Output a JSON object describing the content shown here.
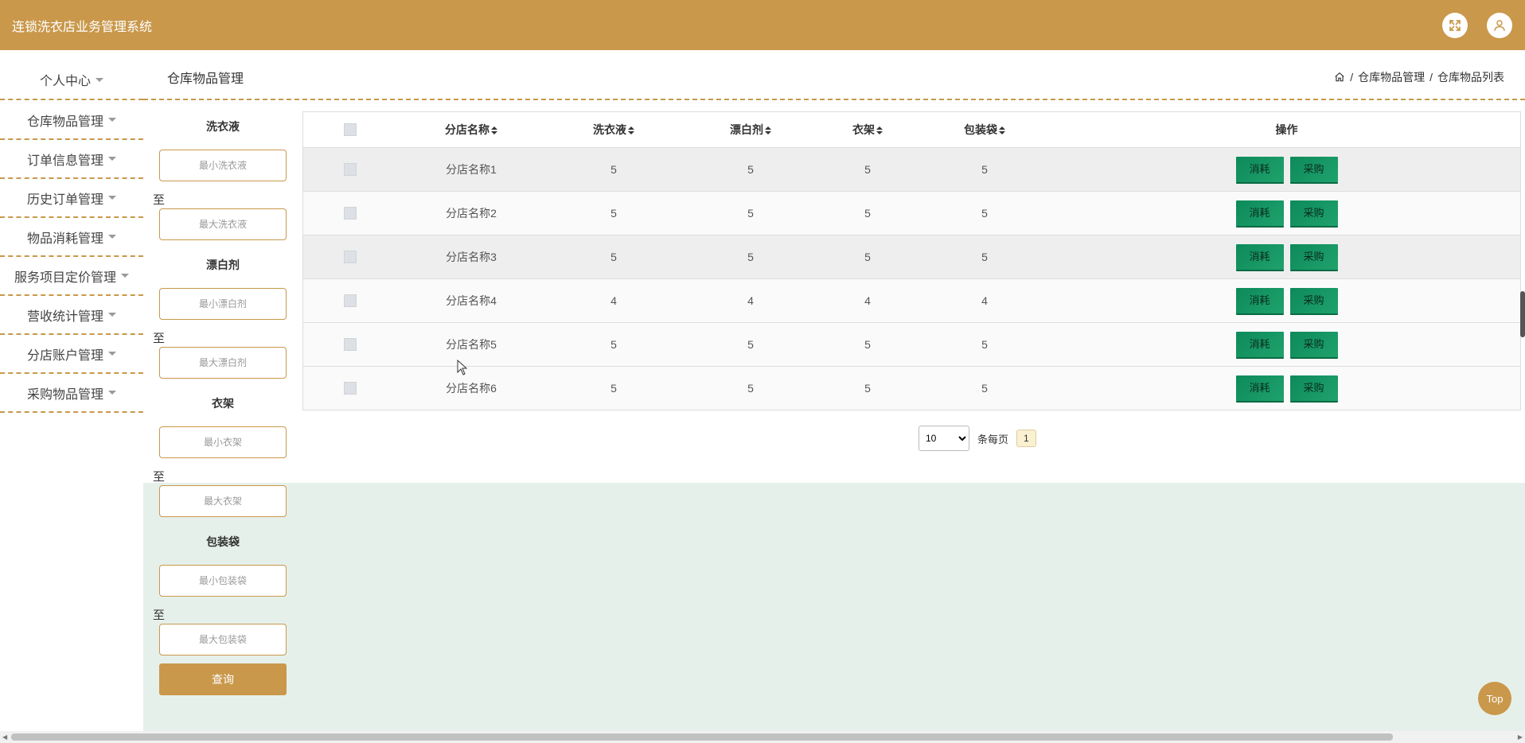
{
  "app": {
    "title": "连锁洗衣店业务管理系统"
  },
  "header_icons": [
    "fullscreen-icon",
    "user-icon"
  ],
  "sidebar": {
    "items": [
      {
        "label": "个人中心"
      },
      {
        "label": "仓库物品管理"
      },
      {
        "label": "订单信息管理"
      },
      {
        "label": "历史订单管理"
      },
      {
        "label": "物品消耗管理"
      },
      {
        "label": "服务项目定价管理"
      },
      {
        "label": "营收统计管理"
      },
      {
        "label": "分店账户管理"
      },
      {
        "label": "采购物品管理"
      }
    ]
  },
  "page": {
    "title": "仓库物品管理",
    "breadcrumb": [
      "仓库物品管理",
      "仓库物品列表"
    ],
    "breadcrumb_sep": "/"
  },
  "filters": {
    "to_label": "至",
    "groups": [
      {
        "label": "洗衣液",
        "min_placeholder": "最小洗衣液",
        "max_placeholder": "最大洗衣液"
      },
      {
        "label": "漂白剂",
        "min_placeholder": "最小漂白剂",
        "max_placeholder": "最大漂白剂"
      },
      {
        "label": "衣架",
        "min_placeholder": "最小衣架",
        "max_placeholder": "最大衣架"
      },
      {
        "label": "包装袋",
        "min_placeholder": "最小包装袋",
        "max_placeholder": "最大包装袋"
      }
    ],
    "query_label": "查询"
  },
  "table": {
    "headers": [
      "分店名称",
      "洗衣液",
      "漂白剂",
      "衣架",
      "包装袋",
      "操作"
    ],
    "rows": [
      [
        "分店名称1",
        "5",
        "5",
        "5",
        "5"
      ],
      [
        "分店名称2",
        "5",
        "5",
        "5",
        "5"
      ],
      [
        "分店名称3",
        "5",
        "5",
        "5",
        "5"
      ],
      [
        "分店名称4",
        "4",
        "4",
        "4",
        "4"
      ],
      [
        "分店名称5",
        "5",
        "5",
        "5",
        "5"
      ],
      [
        "分店名称6",
        "5",
        "5",
        "5",
        "5"
      ]
    ],
    "actions": [
      "消耗",
      "采购"
    ]
  },
  "pagination": {
    "page_size": "10",
    "page_size_options": [
      "10"
    ],
    "per_page_label": "条每页",
    "current_page": "1"
  },
  "top_button": "Top",
  "colors": {
    "brand": "#c9984b",
    "action": "#0d8a5a",
    "panel": "#e6f0ea"
  }
}
